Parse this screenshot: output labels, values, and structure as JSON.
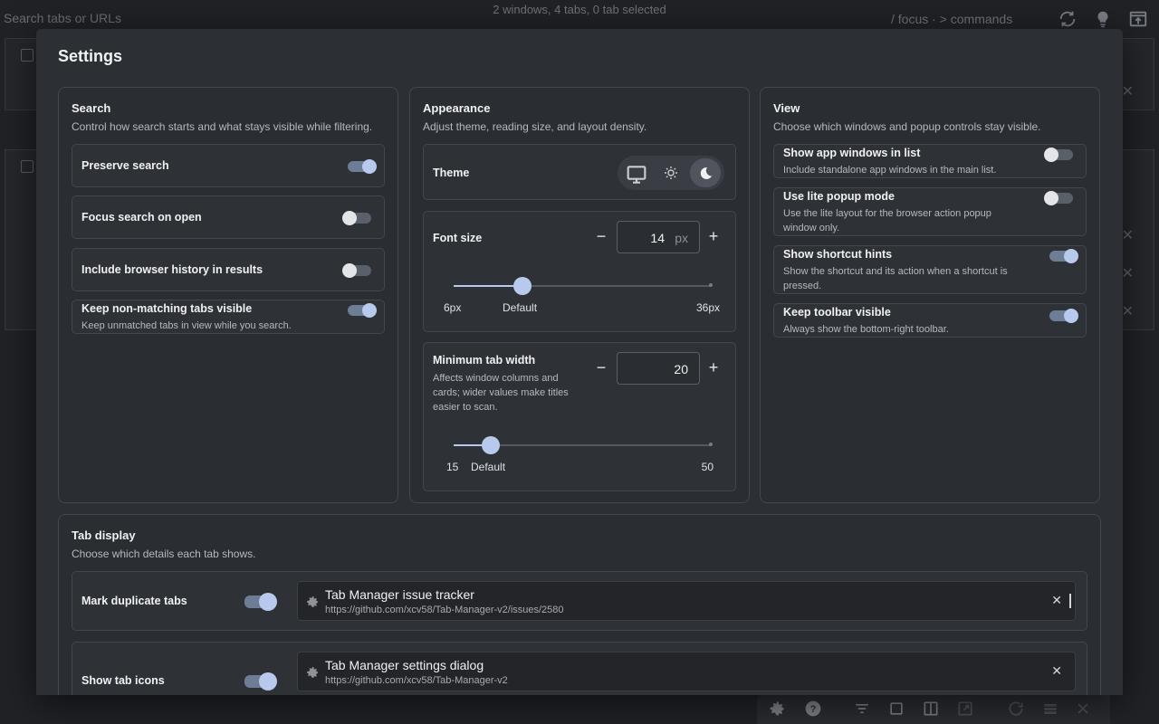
{
  "background": {
    "search_placeholder": "Search tabs or URLs",
    "status": "2 windows, 4 tabs, 0 tab selected",
    "command_hint": "/ focus · > commands"
  },
  "settings": {
    "title": "Settings",
    "search": {
      "title": "Search",
      "subtitle": "Control how search starts and what stays visible while filtering.",
      "rows": [
        {
          "label": "Preserve search",
          "desc": "",
          "on": true
        },
        {
          "label": "Focus search on open",
          "desc": "",
          "on": false
        },
        {
          "label": "Include browser history in results",
          "desc": "",
          "on": false
        },
        {
          "label": "Keep non-matching tabs visible",
          "desc": "Keep unmatched tabs in view while you search.",
          "on": true
        }
      ]
    },
    "appearance": {
      "title": "Appearance",
      "subtitle": "Adjust theme, reading size, and layout density.",
      "theme_label": "Theme",
      "theme_options": [
        "system",
        "light",
        "dark"
      ],
      "theme_selected": "dark",
      "font_size": {
        "label": "Font size",
        "value": "14",
        "unit": "px",
        "min_label": "6px",
        "default_label": "Default",
        "max_label": "36px",
        "min": 6,
        "max": 36,
        "current": 14
      },
      "min_tab_width": {
        "label": "Minimum tab width",
        "desc": "Affects window columns and cards; wider values make titles easier to scan.",
        "value": "20",
        "min_label": "15",
        "default_label": "Default",
        "max_label": "50",
        "min": 15,
        "max": 50,
        "current": 20
      }
    },
    "view": {
      "title": "View",
      "subtitle": "Choose which windows and popup controls stay visible.",
      "rows": [
        {
          "label": "Show app windows in list",
          "desc": "Include standalone app windows in the main list.",
          "on": false
        },
        {
          "label": "Use lite popup mode",
          "desc": "Use the lite layout for the browser action popup window only.",
          "on": false
        },
        {
          "label": "Show shortcut hints",
          "desc": "Show the shortcut and its action when a shortcut is pressed.",
          "on": true
        },
        {
          "label": "Keep toolbar visible",
          "desc": "Always show the bottom-right toolbar.",
          "on": true
        }
      ]
    },
    "tab_display": {
      "title": "Tab display",
      "subtitle": "Choose which details each tab shows.",
      "rows": [
        {
          "label": "Mark duplicate tabs",
          "on": true,
          "preview_title": "Tab Manager issue tracker",
          "preview_url": "https://github.com/xcv58/Tab-Manager-v2/issues/2580"
        },
        {
          "label": "Show tab icons",
          "on": true,
          "preview_title": "Tab Manager settings dialog",
          "preview_url": "https://github.com/xcv58/Tab-Manager-v2"
        }
      ]
    }
  }
}
